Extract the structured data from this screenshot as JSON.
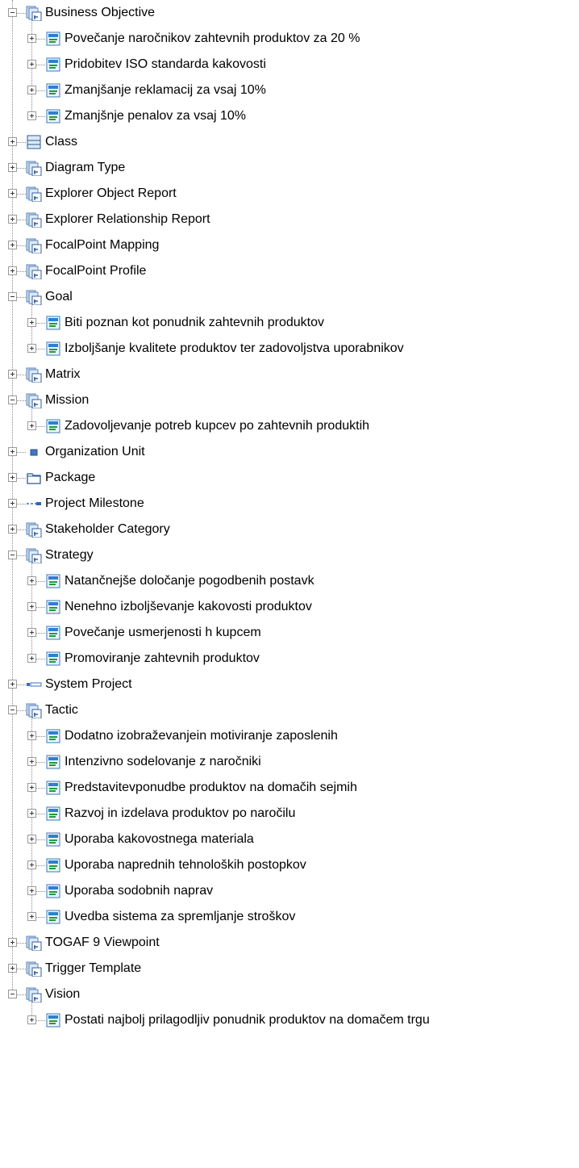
{
  "tree": {
    "nodes": [
      {
        "label": "Business Objective",
        "level": 0,
        "icon": "folder-document-icon",
        "expanded": true
      },
      {
        "label": "Povečanje naročnikov zahtevnih produktov za 20 %",
        "level": 1,
        "icon": "object-instance-icon",
        "expanded": false
      },
      {
        "label": "Pridobitev ISO standarda kakovosti",
        "level": 1,
        "icon": "object-instance-icon",
        "expanded": false
      },
      {
        "label": "Zmanjšanje reklamacij za vsaj 10%",
        "level": 1,
        "icon": "object-instance-icon",
        "expanded": false
      },
      {
        "label": "Zmanjšnje penalov za vsaj 10%",
        "level": 1,
        "icon": "object-instance-icon",
        "expanded": false
      },
      {
        "label": "Class",
        "level": 0,
        "icon": "class-icon",
        "expanded": false
      },
      {
        "label": "Diagram Type",
        "level": 0,
        "icon": "folder-document-icon",
        "expanded": false
      },
      {
        "label": "Explorer Object Report",
        "level": 0,
        "icon": "folder-document-icon",
        "expanded": false
      },
      {
        "label": "Explorer Relationship Report",
        "level": 0,
        "icon": "folder-document-icon",
        "expanded": false
      },
      {
        "label": "FocalPoint Mapping",
        "level": 0,
        "icon": "folder-document-icon",
        "expanded": false
      },
      {
        "label": "FocalPoint Profile",
        "level": 0,
        "icon": "folder-document-icon",
        "expanded": false
      },
      {
        "label": "Goal",
        "level": 0,
        "icon": "folder-document-icon",
        "expanded": true
      },
      {
        "label": "Biti poznan kot ponudnik  zahtevnih produktov",
        "level": 1,
        "icon": "object-instance-icon",
        "expanded": false
      },
      {
        "label": "Izboljšanje kvalitete produktov ter zadovoljstva uporabnikov",
        "level": 1,
        "icon": "object-instance-icon",
        "expanded": false
      },
      {
        "label": "Matrix",
        "level": 0,
        "icon": "folder-document-icon",
        "expanded": false
      },
      {
        "label": "Mission",
        "level": 0,
        "icon": "folder-document-icon",
        "expanded": true
      },
      {
        "label": "Zadovoljevanje potreb kupcev po zahtevnih produktih",
        "level": 1,
        "icon": "object-instance-icon",
        "expanded": false
      },
      {
        "label": "Organization Unit",
        "level": 0,
        "icon": "organization-unit-icon",
        "expanded": false
      },
      {
        "label": "Package",
        "level": 0,
        "icon": "package-icon",
        "expanded": false
      },
      {
        "label": "Project Milestone",
        "level": 0,
        "icon": "milestone-icon",
        "expanded": false
      },
      {
        "label": "Stakeholder Category",
        "level": 0,
        "icon": "folder-document-icon",
        "expanded": false
      },
      {
        "label": "Strategy",
        "level": 0,
        "icon": "folder-document-icon",
        "expanded": true
      },
      {
        "label": "Natančnejše določanje pogodbenih postavk",
        "level": 1,
        "icon": "object-instance-icon",
        "expanded": false
      },
      {
        "label": "Nenehno izboljševanje kakovosti produktov",
        "level": 1,
        "icon": "object-instance-icon",
        "expanded": false
      },
      {
        "label": "Povečanje usmerjenosti h kupcem",
        "level": 1,
        "icon": "object-instance-icon",
        "expanded": false
      },
      {
        "label": "Promoviranje zahtevnih produktov",
        "level": 1,
        "icon": "object-instance-icon",
        "expanded": false
      },
      {
        "label": "System Project",
        "level": 0,
        "icon": "system-project-icon",
        "expanded": false
      },
      {
        "label": "Tactic",
        "level": 0,
        "icon": "folder-document-icon",
        "expanded": true
      },
      {
        "label": "Dodatno izobraževanjein motiviranje zaposlenih",
        "level": 1,
        "icon": "object-instance-icon",
        "expanded": false
      },
      {
        "label": "Intenzivno sodelovanje z naročniki",
        "level": 1,
        "icon": "object-instance-icon",
        "expanded": false
      },
      {
        "label": "Predstavitevponudbe produktov na domačih sejmih",
        "level": 1,
        "icon": "object-instance-icon",
        "expanded": false
      },
      {
        "label": "Razvoj in izdelava produktov po naročilu",
        "level": 1,
        "icon": "object-instance-icon",
        "expanded": false
      },
      {
        "label": "Uporaba kakovostnega materiala",
        "level": 1,
        "icon": "object-instance-icon",
        "expanded": false
      },
      {
        "label": "Uporaba naprednih tehnoloških postopkov",
        "level": 1,
        "icon": "object-instance-icon",
        "expanded": false
      },
      {
        "label": "Uporaba sodobnih naprav",
        "level": 1,
        "icon": "object-instance-icon",
        "expanded": false
      },
      {
        "label": "Uvedba sistema za spremljanje stroškov",
        "level": 1,
        "icon": "object-instance-icon",
        "expanded": false
      },
      {
        "label": "TOGAF 9 Viewpoint",
        "level": 0,
        "icon": "folder-document-icon",
        "expanded": false
      },
      {
        "label": "Trigger Template",
        "level": 0,
        "icon": "folder-document-icon",
        "expanded": false
      },
      {
        "label": "Vision",
        "level": 0,
        "icon": "folder-document-icon",
        "expanded": true
      },
      {
        "label": "Postati najbolj prilagodljiv ponudnik produktov na domačem trgu",
        "level": 1,
        "icon": "object-instance-icon",
        "expanded": false
      }
    ]
  }
}
